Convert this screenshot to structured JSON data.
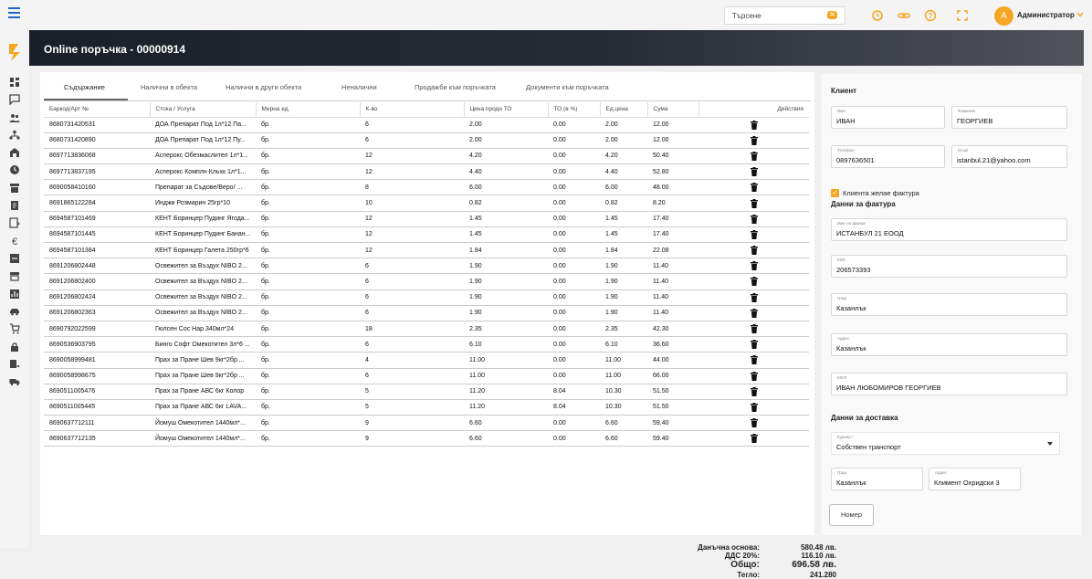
{
  "topbar": {
    "search_placeholder": "Търсене",
    "search_clear": "✕",
    "user_initial": "A",
    "user_name": "Администратор"
  },
  "page": {
    "title": "Online поръчка - 00000914"
  },
  "tabs": [
    {
      "label": "Съдържание",
      "active": true
    },
    {
      "label": "Налични в обекта"
    },
    {
      "label": "Налични в други обекти"
    },
    {
      "label": "Неналични"
    },
    {
      "label": "Продажби към поръчката"
    },
    {
      "label": "Документи към поръчката"
    }
  ],
  "table": {
    "headers": [
      "Баркод/Арт №",
      "Стока / Услуга",
      "Мерна ед.",
      "К-во",
      "Цена продн ТО",
      "ТО (в %)",
      "Ед.цена",
      "Сума",
      "Действия"
    ],
    "rows": [
      [
        "8680731420531",
        "ДОА Препарат Под 1л*12 Па...",
        "бр.",
        "6",
        "2.00",
        "0.00",
        "2.00",
        "12.00"
      ],
      [
        "8680731420890",
        "ДОА Препарат Под 1л*12 Пу...",
        "бр.",
        "6",
        "2.00",
        "0.00",
        "2.00",
        "12.00"
      ],
      [
        "8697713836068",
        "Асперокс Обезмаслител 1л*1...",
        "бр.",
        "12",
        "4.20",
        "0.00",
        "4.20",
        "50.40"
      ],
      [
        "8697713837195",
        "Асперокс Комплн Кльхк 1л*1...",
        "бр.",
        "12",
        "4.40",
        "0.00",
        "4.40",
        "52.80"
      ],
      [
        "8690058410160",
        "Препарат за Съдове/Веро/ ...",
        "бр.",
        "8",
        "6.00",
        "0.00",
        "6.00",
        "48.00"
      ],
      [
        "8691865122284",
        "Инджи Розмарин 25гр*10",
        "бр.",
        "10",
        "0.82",
        "0.00",
        "0.82",
        "8.20"
      ],
      [
        "8694587101469",
        "КЕНТ Боринцер Пудинг Ягода...",
        "бр.",
        "12",
        "1.45",
        "0.00",
        "1.45",
        "17.40"
      ],
      [
        "8694587101445",
        "КЕНТ Боринцер Пудинг Банан...",
        "бр.",
        "12",
        "1.45",
        "0.00",
        "1.45",
        "17.40"
      ],
      [
        "8694587101384",
        "КЕНТ Боринцер Галета 250гр*6",
        "бр.",
        "12",
        "1.84",
        "0.00",
        "1.84",
        "22.08"
      ],
      [
        "8691206802448",
        "Освежител за Въздух NIBO 2...",
        "бр.",
        "6",
        "1.90",
        "0.00",
        "1.90",
        "11.40"
      ],
      [
        "8691206802400",
        "Освежител за Въздух NIBO 2...",
        "бр.",
        "6",
        "1.90",
        "0.00",
        "1.90",
        "11.40"
      ],
      [
        "8691206802424",
        "Освежител за Въздух NIBO 2...",
        "бр.",
        "6",
        "1.90",
        "0.00",
        "1.90",
        "11.40"
      ],
      [
        "8691206802363",
        "Освежител за Въздух NIBO 2...",
        "бр.",
        "6",
        "1.90",
        "0.00",
        "1.90",
        "11.40"
      ],
      [
        "8690792022599",
        "Гюлсен Сос Нар 340мл*24",
        "бр.",
        "18",
        "2.35",
        "0.00",
        "2.35",
        "42.30"
      ],
      [
        "8690536903795",
        "Бинго Софт Омекотител 3л*6 ...",
        "бр.",
        "6",
        "6.10",
        "0.00",
        "6.10",
        "36.60"
      ],
      [
        "8690058999481",
        "Прах за Пране Шев 9кг*2бр ...",
        "бр.",
        "4",
        "11.00",
        "0.00",
        "11.00",
        "44.00"
      ],
      [
        "8690058998675",
        "Прах за Пране Шев 9кг*2бр ...",
        "бр.",
        "6",
        "11.00",
        "0.00",
        "11.00",
        "66.00"
      ],
      [
        "8690511005476",
        "Прах за Пране АВС 6кг Колор",
        "бр.",
        "5",
        "11.20",
        "8.04",
        "10.30",
        "51.50"
      ],
      [
        "8690511005445",
        "Прах за Пране АВС 6кг LAVA...",
        "бр.",
        "5",
        "11.20",
        "8.04",
        "10.30",
        "51.50"
      ],
      [
        "8690637712111",
        "Йомуш Омекотител 1440мл*...",
        "бр.",
        "9",
        "6.60",
        "0.00",
        "6.60",
        "59.40"
      ],
      [
        "8690637712135",
        "Йомуш Омекотител 1440мл*...",
        "бр.",
        "9",
        "6.60",
        "0.00",
        "6.60",
        "59.40"
      ]
    ]
  },
  "totals": {
    "base_label": "Данъчна основа:",
    "base_value": "580.48 лв.",
    "vat_label": "ДДС 20%:",
    "vat_value": "116.10 лв.",
    "total_label": "Общо:",
    "total_value": "696.58 лв.",
    "weight_label": "Тегло:",
    "weight_value": "241.280"
  },
  "client": {
    "title": "Клиент",
    "first_name_label": "Име",
    "first_name": "ИВАН",
    "last_name_label": "Фамилия",
    "last_name": "ГЕОРГИЕВ",
    "phone_label": "Телефон",
    "phone": "0897636501",
    "email_label": "Email",
    "email": "istanbul.21@yahoo.com",
    "invoice_checkbox_label": "Клиента желае фактура"
  },
  "invoice": {
    "title": "Данни за фактура",
    "company_label": "Име на фирма",
    "company": "ИСТАНБУЛ 21 ЕООД",
    "eik_label": "ЕИК",
    "eik": "206573393",
    "city_label": "Град",
    "city": "Казанлък",
    "address_label": "Адрес",
    "address": "Казанлък",
    "mol_label": "МОЛ",
    "mol": "ИВАН ЛЮБОМИРОВ ГЕОРГИЕВ"
  },
  "delivery": {
    "title": "Данни за доставка",
    "courier_label": "Куриер *",
    "courier": "Собствен транспорт",
    "city_label": "Град",
    "city": "Казанлък",
    "address_label": "Адрес",
    "address": "Климент Охридски 3",
    "number_button": "Номер"
  },
  "colors": {
    "accent": "#f5a623",
    "header_dark": "#1b1f27",
    "link_blue": "#2563c9"
  }
}
